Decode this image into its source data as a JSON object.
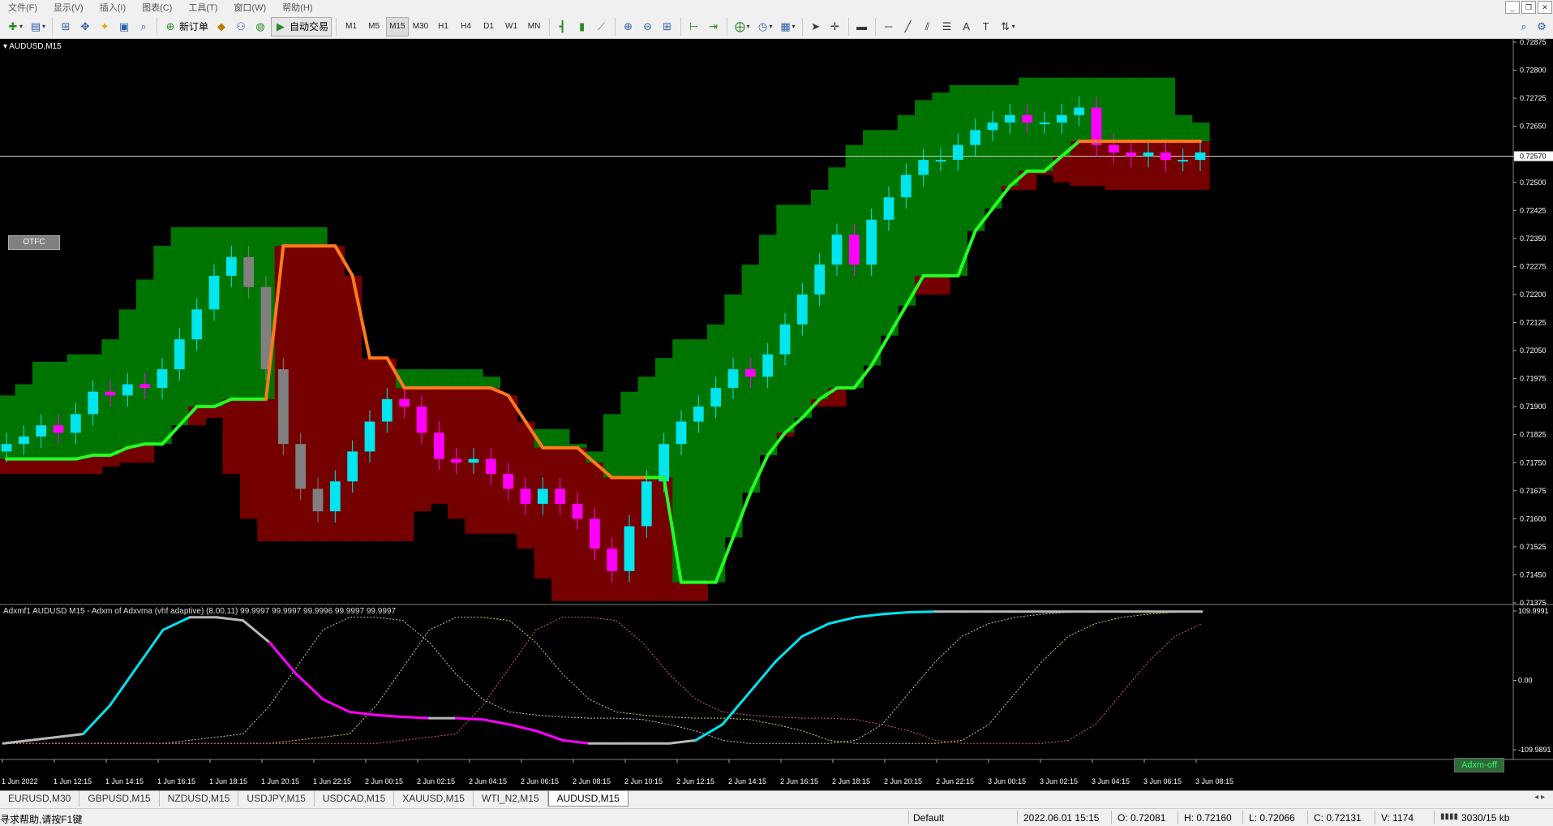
{
  "menubar": {
    "items": [
      "文件(F)",
      "显示(V)",
      "插入(I)",
      "图表(C)",
      "工具(T)",
      "窗口(W)",
      "帮助(H)"
    ],
    "controls": [
      "_",
      "❐",
      "✕"
    ]
  },
  "toolbar": {
    "new_order": "新订单",
    "auto_trade": "自动交易",
    "timeframes": [
      "M1",
      "M5",
      "M15",
      "M30",
      "H1",
      "H4",
      "D1",
      "W1",
      "MN"
    ],
    "active_timeframe": "M15"
  },
  "chart": {
    "symbol": "AUDUSD,M15",
    "otfc_label": "OTFC",
    "current_price": "0.72570",
    "indicator_label": "Adxmf1 AUDUSD M15 - Adxm of Adxvma (vhf adaptive) (8.00,11) 99.9997 99.9997 99.9996 99.9997 99.9997",
    "adxm_button": "Adxm-off",
    "price_ticks": [
      "0.72875",
      "0.72800",
      "0.72725",
      "0.72650",
      "0.72570",
      "0.72500",
      "0.72425",
      "0.72350",
      "0.72275",
      "0.72200",
      "0.72125",
      "0.72050",
      "0.71975",
      "0.71900",
      "0.71825",
      "0.71750",
      "0.71675",
      "0.71600",
      "0.71525",
      "0.71450",
      "0.71375"
    ],
    "indicator_ticks": [
      "109.9991",
      "0.00",
      "-109.9891"
    ],
    "time_ticks": [
      "1 Jun 2022",
      "1 Jun 12:15",
      "1 Jun 14:15",
      "1 Jun 16:15",
      "1 Jun 18:15",
      "1 Jun 20:15",
      "1 Jun 22:15",
      "2 Jun 00:15",
      "2 Jun 02:15",
      "2 Jun 04:15",
      "2 Jun 06:15",
      "2 Jun 08:15",
      "2 Jun 10:15",
      "2 Jun 12:15",
      "2 Jun 14:15",
      "2 Jun 16:15",
      "2 Jun 18:15",
      "2 Jun 20:15",
      "2 Jun 22:15",
      "3 Jun 00:15",
      "3 Jun 02:15",
      "3 Jun 04:15",
      "3 Jun 06:15",
      "3 Jun 08:15"
    ],
    "colors": {
      "bull": "#00e5ee",
      "bear": "#ff00ff",
      "neutral": "#808080",
      "trend_up": "#22ff22",
      "trend_down": "#ff7a1a",
      "zone_green": "#007a00",
      "zone_red": "#7a0000"
    }
  },
  "chart_data": {
    "type": "candlestick",
    "symbol": "AUDUSD,M15",
    "ylim": [
      0.71375,
      0.72875
    ],
    "x_labels": [
      "1 Jun 2022",
      "1 Jun 12:15",
      "1 Jun 14:15",
      "1 Jun 16:15",
      "1 Jun 18:15",
      "1 Jun 20:15",
      "1 Jun 22:15",
      "2 Jun 00:15",
      "2 Jun 02:15",
      "2 Jun 04:15",
      "2 Jun 06:15",
      "2 Jun 08:15",
      "2 Jun 10:15",
      "2 Jun 12:15",
      "2 Jun 14:15",
      "2 Jun 16:15",
      "2 Jun 18:15",
      "2 Jun 20:15",
      "2 Jun 22:15",
      "3 Jun 00:15",
      "3 Jun 02:15",
      "3 Jun 04:15",
      "3 Jun 06:15",
      "3 Jun 08:15"
    ],
    "close_path": [
      0.718,
      0.7182,
      0.7185,
      0.7183,
      0.7188,
      0.7194,
      0.7193,
      0.7196,
      0.7195,
      0.72,
      0.7208,
      0.7216,
      0.7225,
      0.723,
      0.7222,
      0.72,
      0.718,
      0.7168,
      0.7162,
      0.717,
      0.7178,
      0.7186,
      0.7192,
      0.719,
      0.7183,
      0.7176,
      0.7175,
      0.7176,
      0.7172,
      0.7168,
      0.7164,
      0.7168,
      0.7164,
      0.716,
      0.7152,
      0.7146,
      0.7158,
      0.717,
      0.718,
      0.7186,
      0.719,
      0.7195,
      0.72,
      0.7198,
      0.7204,
      0.7212,
      0.722,
      0.7228,
      0.7236,
      0.7228,
      0.724,
      0.7246,
      0.7252,
      0.7256,
      0.7256,
      0.726,
      0.7264,
      0.7266,
      0.7268,
      0.7266,
      0.7266,
      0.7268,
      0.727,
      0.726,
      0.7258,
      0.7257,
      0.7258,
      0.7256,
      0.7256,
      0.7258
    ],
    "indicator": {
      "name": "Adxm of Adxvma (vhf adaptive)",
      "range": [
        -109.9891,
        109.9991
      ],
      "values": [
        -100,
        -95,
        -90,
        -85,
        -40,
        20,
        80,
        100,
        100,
        95,
        60,
        10,
        -30,
        -50,
        -55,
        -58,
        -60,
        -60,
        -62,
        -70,
        -80,
        -95,
        -100,
        -100,
        -100,
        -100,
        -95,
        -70,
        -20,
        30,
        70,
        90,
        100,
        105,
        108,
        109,
        109,
        109,
        109,
        109,
        109,
        109,
        109,
        109,
        109,
        109
      ]
    }
  },
  "tabs": {
    "items": [
      "EURUSD,M30",
      "GBPUSD,M15",
      "NZDUSD,M15",
      "USDJPY,M15",
      "USDCAD,M15",
      "XAUUSD,M15",
      "WTI_N2,M15",
      "AUDUSD,M15"
    ],
    "active": "AUDUSD,M15",
    "arrows": "◂ ▸"
  },
  "status": {
    "help": "寻求帮助,请按F1键",
    "profile": "Default",
    "datetime": "2022.06.01 15:15",
    "open": "O: 0.72081",
    "high": "H: 0.72160",
    "low": "L: 0.72066",
    "close": "C: 0.72131",
    "volume": "V: 1174",
    "traffic": "3030/15 kb"
  }
}
